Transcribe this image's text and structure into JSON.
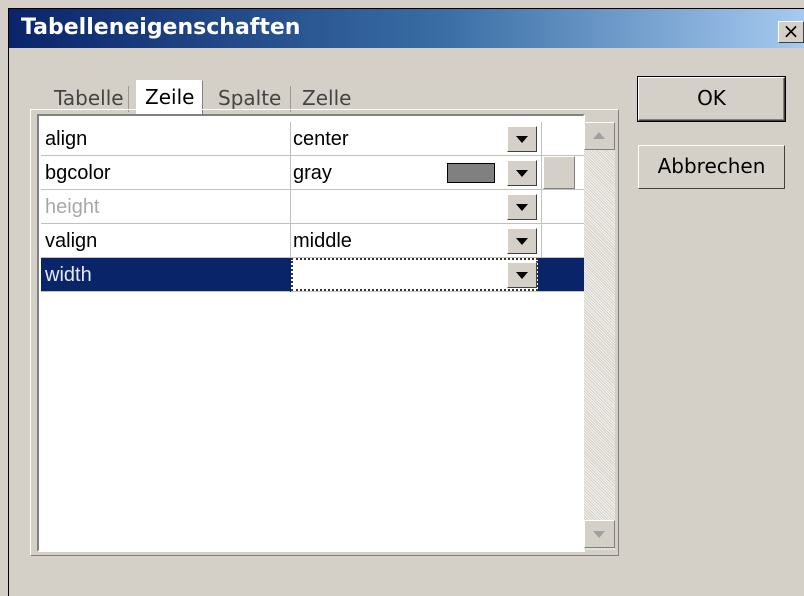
{
  "window": {
    "title": "Tabelleneigenschaften",
    "close_label": "×"
  },
  "tabs": [
    {
      "label": "Tabelle",
      "active": false
    },
    {
      "label": "Zeile",
      "active": true
    },
    {
      "label": "Spalte",
      "active": false
    },
    {
      "label": "Zelle",
      "active": false
    }
  ],
  "properties": [
    {
      "name": "align",
      "value": "center",
      "disabled": false
    },
    {
      "name": "bgcolor",
      "value": "gray",
      "swatch_color": "#808080",
      "disabled": false
    },
    {
      "name": "height",
      "value": "",
      "disabled": true
    },
    {
      "name": "valign",
      "value": "middle",
      "disabled": false
    },
    {
      "name": "width",
      "value": "",
      "selected": true,
      "disabled": false
    }
  ],
  "buttons": {
    "ok": "OK",
    "cancel": "Abbrechen"
  },
  "colors": {
    "selection": "#0a246a",
    "face": "#d4d0c8"
  }
}
